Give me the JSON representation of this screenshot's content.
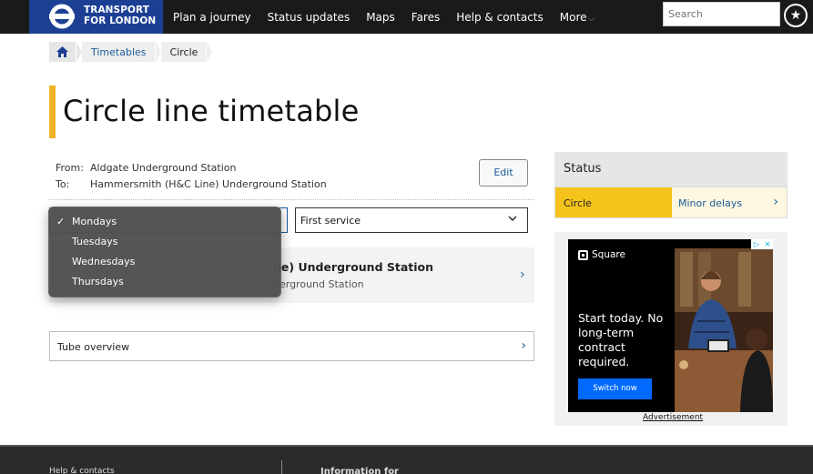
{
  "header": {
    "brand_line1": "TRANSPORT",
    "brand_line2": "FOR LONDON",
    "nav": [
      "Plan a journey",
      "Status updates",
      "Maps",
      "Fares",
      "Help & contacts"
    ],
    "more_label": "More",
    "search_placeholder": "Search",
    "brand_color": "#1c3f94"
  },
  "breadcrumb": {
    "items": [
      "Timetables",
      "Circle"
    ]
  },
  "page": {
    "title": "Circle line timetable",
    "accent_color": "#f0b429"
  },
  "journey": {
    "from_label": "From:",
    "from_value": "Aldgate Underground Station",
    "to_label": "To:",
    "to_value": "Hammersmith (H&C Line) Underground Station",
    "edit_label": "Edit"
  },
  "selects": {
    "service_value": "First service"
  },
  "day_dropdown": {
    "options": [
      "Mondays",
      "Tuesdays",
      "Wednesdays",
      "Thursdays"
    ],
    "selected_index": 0
  },
  "station_row": {
    "main_text": "ne) Underground Station",
    "sub_text": "derground Station"
  },
  "tube_overview": {
    "label": "Tube overview"
  },
  "status": {
    "heading": "Status",
    "line": "Circle",
    "state": "Minor delays",
    "line_color": "#f6c31c"
  },
  "ad": {
    "brand": "Square",
    "headline": "Start today. No long-term contract required.",
    "cta": "Switch now",
    "label": "Advertisement"
  },
  "footer": {
    "col1": "Help & contacts",
    "col2": "Information for"
  }
}
